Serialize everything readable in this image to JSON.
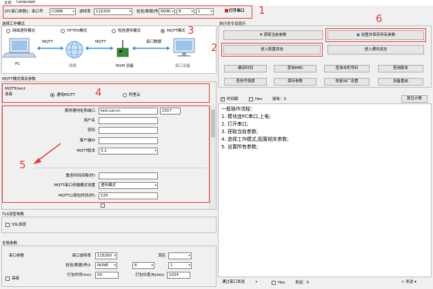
{
  "menu": {
    "file": "文件",
    "language": "Language"
  },
  "toolbar": {
    "pc_params": "[PC串口参数]：串口号",
    "port": "COM6",
    "baud_label": "波特率",
    "baud": "115200",
    "parity_label": "检验/数据/停止",
    "parity": "NONI",
    "databits": "8",
    "stopbits": "1",
    "open_port": "打开串口"
  },
  "annotations": {
    "n1": "1",
    "n2": "2",
    "n3": "3",
    "n4": "4",
    "n5": "5",
    "n6": "6"
  },
  "work_mode": {
    "title": "选择工作模式",
    "options": [
      "网络透传模式",
      "HTTPD模式",
      "短信透传模式",
      "MQTT模式"
    ],
    "diagram": {
      "link1": "MQTT",
      "link2": "MQTT",
      "link3": "串口数据",
      "pc": "PC",
      "network": "网络",
      "device": "M2M 设备",
      "serial_dev": "串口设备"
    }
  },
  "mqtt_params": {
    "title": "MQTT模式相关参数",
    "client_label1": "MQTTclient",
    "client_label2": "连接",
    "opt_generic": "通用MQTT",
    "opt_aliyun": "阿里云",
    "server_label": "服务器地址和端口",
    "server": "test.usr.cn",
    "port": "2317",
    "username_label": "用户名",
    "password_label": "密码",
    "clientid_label": "客户端ID",
    "version_label": "MQTT版本",
    "version": "3.1",
    "reconnect_label": "重连时间间隔(秒)",
    "transfer_label": "MQTT串口传输模式设置",
    "transfer": "透传模式",
    "heartbeat_label": "MQTT心跳包时间(秒)",
    "heartbeat": "120"
  },
  "tls": {
    "title": "TLS加密参数",
    "ssl": "SSL加密"
  },
  "global": {
    "title": "全局参数",
    "serial_label": "串口参数",
    "baud_label": "串口波特率",
    "baud": "115200",
    "flow_label": "流控",
    "parity_label": "检验/数据/停止",
    "parity": "NONE",
    "databits": "8",
    "stopbits": "1",
    "pack_time_label": "打包时间(ms)",
    "pack_time": "50",
    "pack_len_label": "打包长度(Bytes)",
    "pack_len": "1024",
    "advanced": "高级"
  },
  "commands": {
    "title": "执行命令及提示",
    "get_params": "获取当前参数",
    "save_all": "设置并保存所有参数",
    "enter_config": "进入配置状态",
    "enter_comm": "进入通讯状态",
    "row1": [
      "编译时间",
      "查询IMEI",
      "查询本机号码",
      "查询版本"
    ],
    "row2": [
      "查信号强度",
      "保存参数",
      "恢复出厂设置",
      "设备重启"
    ]
  },
  "log": {
    "timestamp": "时间戳",
    "hex": "Hex",
    "recv": "接收：0",
    "reset": "复位计数",
    "lines": [
      "一般操作流程：",
      "1. 模块连PC串口,上电;",
      "2. 打开串口;",
      "3. 获取当前参数;",
      "4. 选择工作模式,配置相关参数;",
      "5. 设置所有参数;"
    ]
  },
  "footer": {
    "via": "通过串口发送",
    "hex": "Hex",
    "send_count": "发送：0",
    "send": "发送"
  },
  "colors": {
    "annotation_red": "#e53935",
    "diagram_blue": "#2f8fd8"
  }
}
